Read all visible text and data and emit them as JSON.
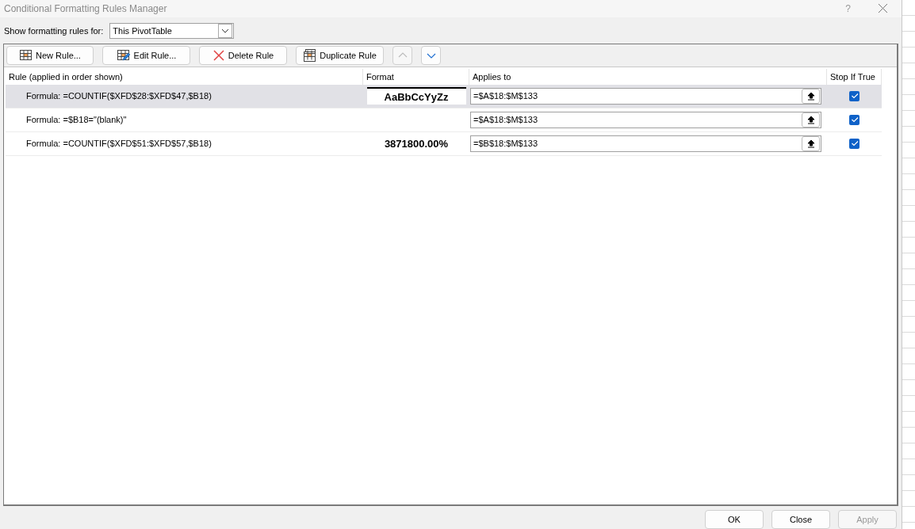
{
  "window": {
    "title": "Conditional Formatting Rules Manager",
    "help": "?"
  },
  "scope": {
    "label": "Show formatting rules for:",
    "value": "This PivotTable"
  },
  "toolbar": [
    {
      "kind": "new",
      "label": "New Rule...",
      "disabled": false
    },
    {
      "kind": "edit",
      "label": "Edit Rule...",
      "disabled": false
    },
    {
      "kind": "delete",
      "label": "Delete Rule",
      "disabled": false
    },
    {
      "kind": "duplicate",
      "label": "Duplicate Rule",
      "disabled": false
    },
    {
      "kind": "move-up",
      "disabled": true
    },
    {
      "kind": "move-down",
      "disabled": false
    }
  ],
  "table": {
    "columns": [
      "Rule (applied in order shown)",
      "Format",
      "Applies to",
      "Stop If True"
    ],
    "rows": [
      {
        "rule": "Formula: =COUNTIF($XFD$28:$XFD$47,$B18)",
        "format_preview": "AaBbCcYyZz",
        "applies_to": "=$A$18:$M$133",
        "stop_if_true": true,
        "selected": true
      },
      {
        "rule": "Formula: =$B18=\"(blank)\"",
        "applies_to": "=$A$18:$M$133",
        "stop_if_true": true,
        "selected": false
      },
      {
        "rule": "Formula: =COUNTIF($XFD$51:$XFD$57,$B18)",
        "format_preview": "3871800.00%",
        "applies_to": "=$B$18:$M$133",
        "stop_if_true": true,
        "selected": false
      }
    ]
  },
  "buttons": [
    {
      "label": "OK",
      "disabled": false
    },
    {
      "label": "Close",
      "disabled": false
    },
    {
      "label": "Apply",
      "disabled": true
    }
  ]
}
